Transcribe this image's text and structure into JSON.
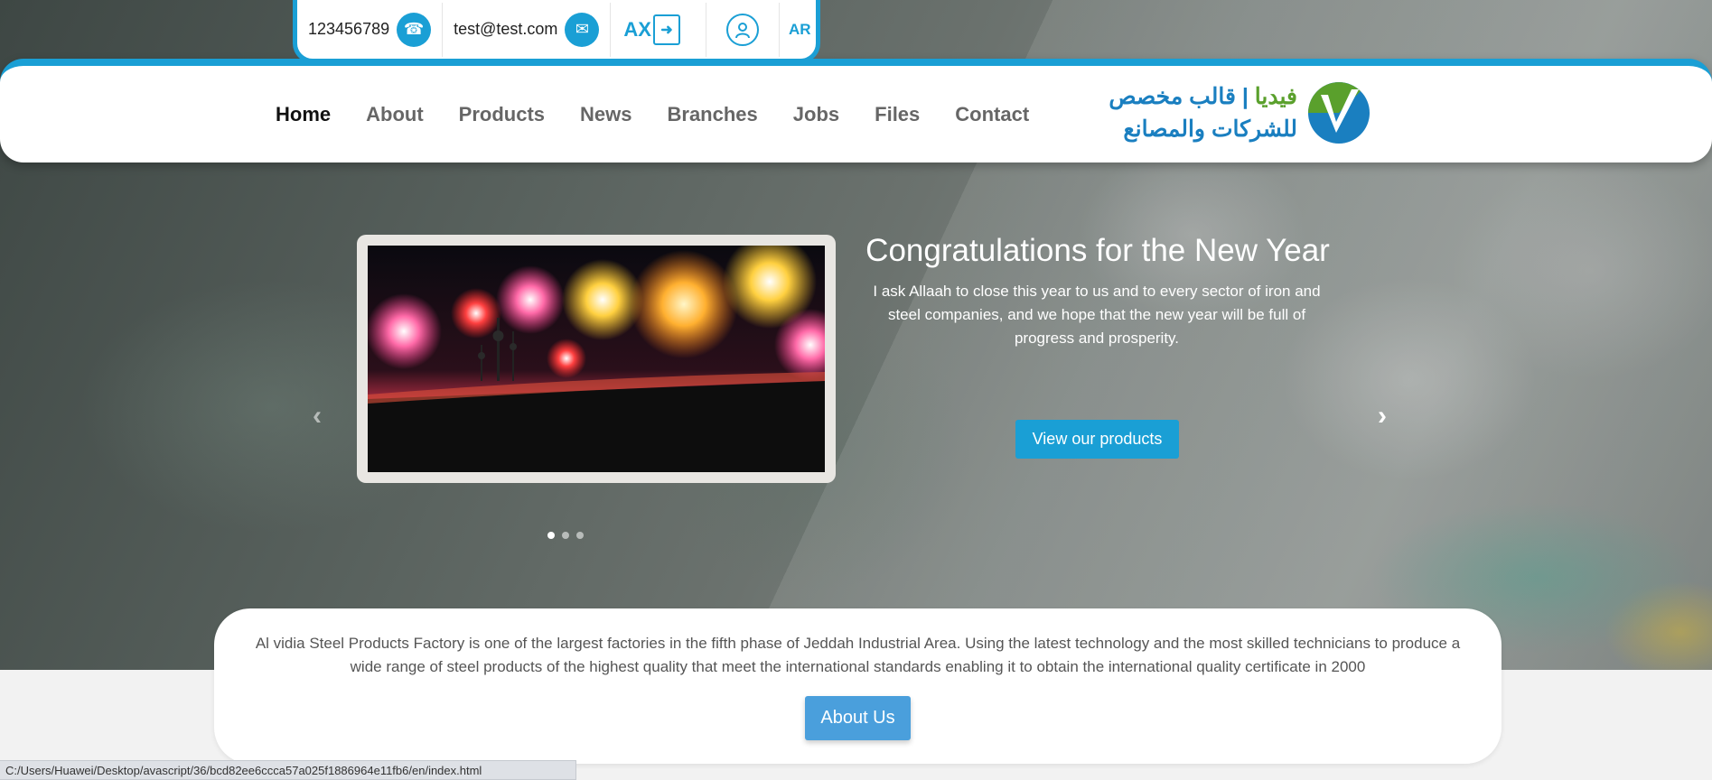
{
  "topbar": {
    "phone": "123456789",
    "email": "test@test.com",
    "logout_label": "AX",
    "language": "AR"
  },
  "logo": {
    "line1_part1": "فيديا",
    "line1_sep": "|",
    "line1_part2": "قالب مخصص",
    "line2": "للشركات والمصانع"
  },
  "nav": {
    "items": [
      {
        "label": "Home",
        "active": true
      },
      {
        "label": "About"
      },
      {
        "label": "Products"
      },
      {
        "label": "News"
      },
      {
        "label": "Branches"
      },
      {
        "label": "Jobs"
      },
      {
        "label": "Files"
      },
      {
        "label": "Contact"
      }
    ]
  },
  "slider": {
    "title": "Congratulations for the New Year",
    "description": "I ask Allaah to close this year to us and to every sector of iron and steel companies, and we hope that the new year will be full of progress and prosperity.",
    "button_label": "View our products",
    "prev_icon": "‹",
    "next_icon": "›",
    "dots": 3,
    "active_dot": 1
  },
  "about": {
    "text": "Al vidia Steel Products Factory is one of the largest factories in the fifth phase of Jeddah Industrial Area. Using the latest technology and the most skilled technicians to produce a wide range of steel products of the highest quality that meet the international standards enabling it to obtain the international quality certificate in 2000",
    "button_label": "About Us"
  },
  "status_url": "C:/Users/Huawei/Desktop/avascript/36/bcd82ee6ccca57a025f1886964e11fb6/en/index.html",
  "colors": {
    "accent": "#1a9fd5",
    "logo_green": "#5aa02c",
    "logo_blue": "#1a7fc0",
    "about_button": "#4a9fdc"
  }
}
